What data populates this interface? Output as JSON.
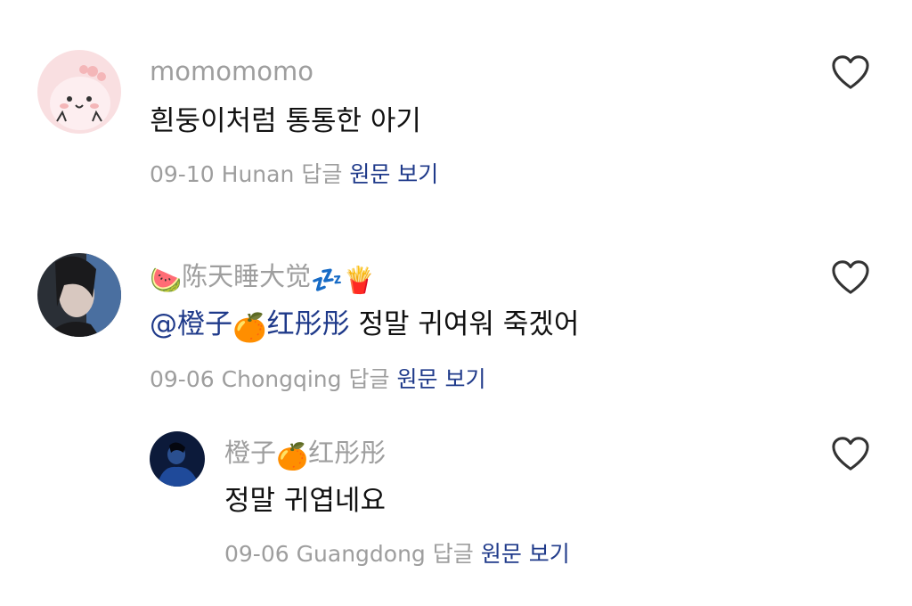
{
  "comments": [
    {
      "author": "momomomo",
      "text": "흰둥이처럼 통통한 아기",
      "date": "09-10",
      "location": "Hunan",
      "reply_label": "답글",
      "view_original_label": "원문 보기",
      "avatar_icon": "pink-cartoon-creature-avatar",
      "heart_icon": "heart-outline-icon"
    },
    {
      "author": "陈天睡大觉",
      "author_prefix_emoji": "🍉",
      "author_suffix_emoji": "💤🍟",
      "mention_prefix": "@",
      "mention_name": "橙子",
      "mention_emoji": "🍊",
      "mention_name_2": "红彤彤",
      "text": "정말 귀여워 죽겠어",
      "date": "09-06",
      "location": "Chongqing",
      "reply_label": "답글",
      "view_original_label": "원문 보기",
      "avatar_icon": "photo-portrait-avatar",
      "heart_icon": "heart-outline-icon"
    },
    {
      "author": "橙子",
      "author_emoji": "🍊",
      "author_2": "红彤彤",
      "text": "정말 귀엽네요",
      "date": "09-06",
      "location": "Guangdong",
      "reply_label": "답글",
      "view_original_label": "원문 보기",
      "avatar_icon": "dark-blue-photo-avatar",
      "heart_icon": "heart-outline-icon"
    }
  ],
  "colors": {
    "author": "#9e9e9e",
    "text": "#111111",
    "link": "#1f3a8a"
  }
}
